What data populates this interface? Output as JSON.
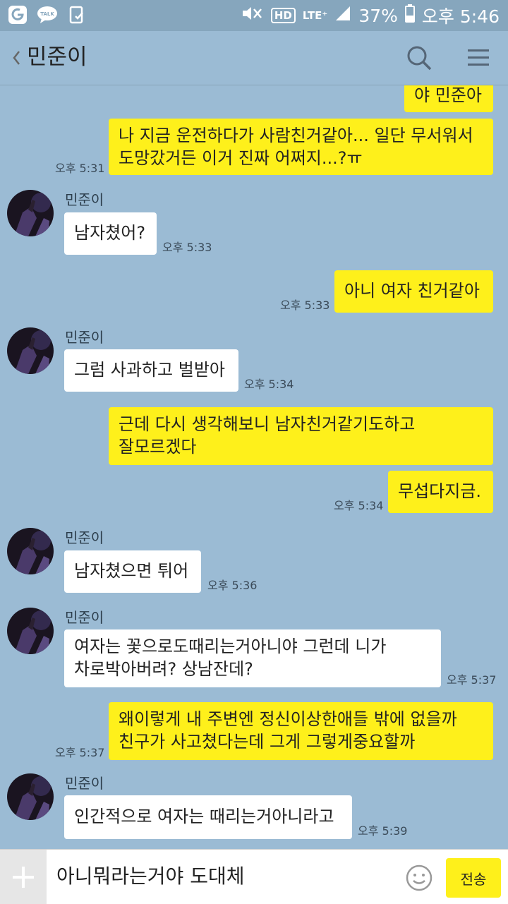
{
  "status_bar": {
    "battery": "37%",
    "time": "오후 5:46",
    "hd": "HD",
    "lte": "LTE⁺",
    "icons": [
      "app-icon",
      "talk-icon",
      "clipboard-icon",
      "mute-icon",
      "hd-icon",
      "lte-icon",
      "signal-icon",
      "battery-icon"
    ]
  },
  "header": {
    "title": "민준이",
    "icons": [
      "back-chevron-icon",
      "search-icon",
      "menu-icon"
    ]
  },
  "messages": [
    {
      "type": "sent",
      "text": "야 민준아"
    },
    {
      "type": "sent",
      "line1": "나 지금 운전하다가 사람친거같아... 일단 무서워서",
      "line2": "도망갔거든 이거 진짜 어쩌지...?ㅠ",
      "time": "오후 5:31"
    },
    {
      "type": "received",
      "sender": "민준이",
      "text": "남자쳤어?",
      "time": "오후 5:33"
    },
    {
      "type": "sent",
      "text": "아니 여자 친거같아",
      "time": "오후 5:33"
    },
    {
      "type": "received",
      "sender": "민준이",
      "text": "그럼 사과하고 벌받아",
      "time": "오후 5:34"
    },
    {
      "type": "sent",
      "line1": "근데 다시 생각해보니 남자친거같기도하고",
      "line2": "잘모르겠다"
    },
    {
      "type": "sent",
      "text": "무섭다지금.",
      "time": "오후 5:34"
    },
    {
      "type": "received",
      "sender": "민준이",
      "text": "남자쳤으면 튀어",
      "time": "오후 5:36"
    },
    {
      "type": "received",
      "sender": "민준이",
      "line1": "여자는 꽃으로도때리는거아니야 그런데 니가",
      "line2": "차로박아버려? 상남잔데?",
      "time": "오후 5:37"
    },
    {
      "type": "sent",
      "line1": "왜이렇게 내 주변엔 정신이상한애들 밖에 없을까",
      "line2": "친구가 사고쳤다는데 그게 그렇게중요할까",
      "time": "오후 5:37"
    },
    {
      "type": "received",
      "sender": "민준이",
      "text": "인간적으로 여자는 때리는거아니라고",
      "time": "오후 5:39"
    }
  ],
  "input": {
    "value": "아니뭐라는거야 도대체",
    "send_label": "전송",
    "icons": [
      "plus-icon",
      "emoji-icon"
    ]
  },
  "colors": {
    "chat_background": "#9bbbd4",
    "status_bar": "#86a6bd",
    "sent_bubble": "#fef01b",
    "received_bubble": "#ffffff"
  }
}
